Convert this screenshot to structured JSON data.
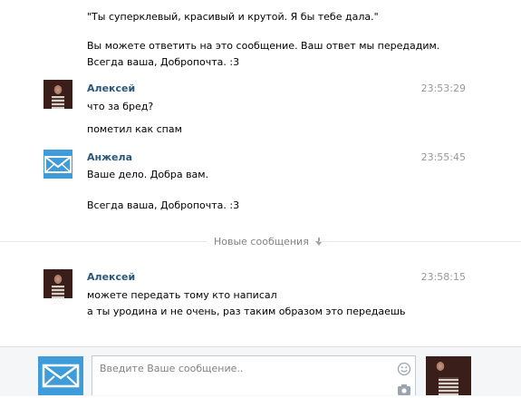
{
  "prev_message": {
    "lines": [
      "\"Ты суперклевый, красивый и крутой. Я бы тебе дала.\"",
      "Вы можете ответить на это сообщение. Ваш ответ мы передадим.",
      "Всегда ваша, Добропочта. :3"
    ]
  },
  "messages": [
    {
      "author": "Алексей",
      "time": "23:53:29",
      "avatar_icon": "user-photo",
      "lines": [
        "что за бред?",
        "пометил как спам"
      ]
    },
    {
      "author": "Анжела",
      "time": "23:55:45",
      "avatar_icon": "envelope-icon",
      "lines": [
        "Ваше дело. Добра вам.",
        "Всегда ваша, Добропочта. :3"
      ]
    },
    {
      "author": "Алексей",
      "time": "23:58:15",
      "avatar_icon": "user-photo",
      "lines": [
        "можете передать тому кто написал",
        "а ты уродина и не очень, раз таким образом это передаешь"
      ]
    }
  ],
  "divider": {
    "label": "Новые сообщения",
    "icon": "arrow-down-icon"
  },
  "composer": {
    "placeholder": "Введите Ваше сообщение..",
    "value": "",
    "icons": [
      "envelope-icon",
      "smiley-icon",
      "camera-icon",
      "user-photo"
    ]
  },
  "colors": {
    "author": "#2b587a",
    "time": "#999999",
    "accent": "#3f9cda",
    "divider_text": "#828282"
  }
}
